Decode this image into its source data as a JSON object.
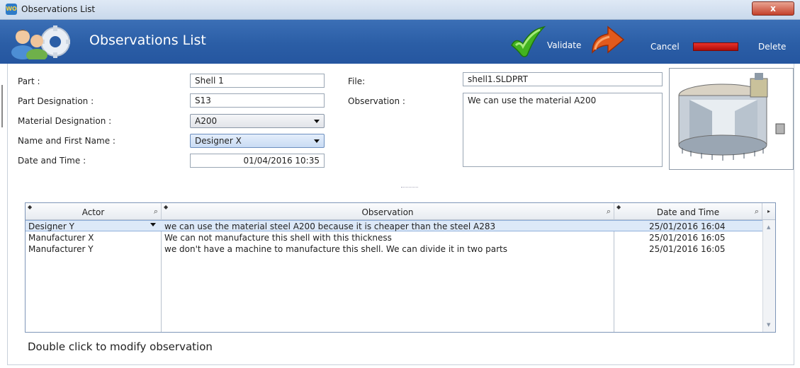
{
  "window": {
    "title": "Observations List",
    "app_icon": "wo-app-icon",
    "close_label": "x"
  },
  "header": {
    "title": "Observations List",
    "users_icon": "users-gear-icon",
    "validate_label": "Validate",
    "cancel_label": "Cancel",
    "delete_label": "Delete",
    "colors": {
      "band": "#2b5ea6",
      "validate": "#3fae1f",
      "cancel": "#e0521c",
      "delete_bar": "#d61a14"
    }
  },
  "form": {
    "part_label": "Part :",
    "part_value": "Shell 1",
    "part_designation_label": "Part Designation :",
    "part_designation_value": "S13",
    "material_label": "Material Designation  :",
    "material_value": "A200",
    "name_label": "Name and First Name :",
    "name_value": "Designer X",
    "date_label": "Date and Time :",
    "date_value": "01/04/2016 10:35",
    "file_label": "File:",
    "file_value": "shell1.SLDPRT",
    "observation_label": "Observation :",
    "observation_value": "We can use the material A200",
    "preview_icon": "shell-cad-preview-icon"
  },
  "grid": {
    "columns": [
      "Actor",
      "Observation",
      "Date and Time"
    ],
    "rows": [
      {
        "actor": "Designer Y",
        "observation": "we can use the material steel A200 because it is cheaper than the steel A283",
        "date": "25/01/2016 16:04",
        "selected": true
      },
      {
        "actor": "Manufacturer X",
        "observation": "We can not manufacture this shell with this thickness",
        "date": "25/01/2016 16:05",
        "selected": false
      },
      {
        "actor": "Manufacturer Y",
        "observation": "we don't have a machine to manufacture this shell. We can divide it in two parts",
        "date": "25/01/2016 16:05",
        "selected": false
      }
    ]
  },
  "hint": "Double click to modify observation"
}
